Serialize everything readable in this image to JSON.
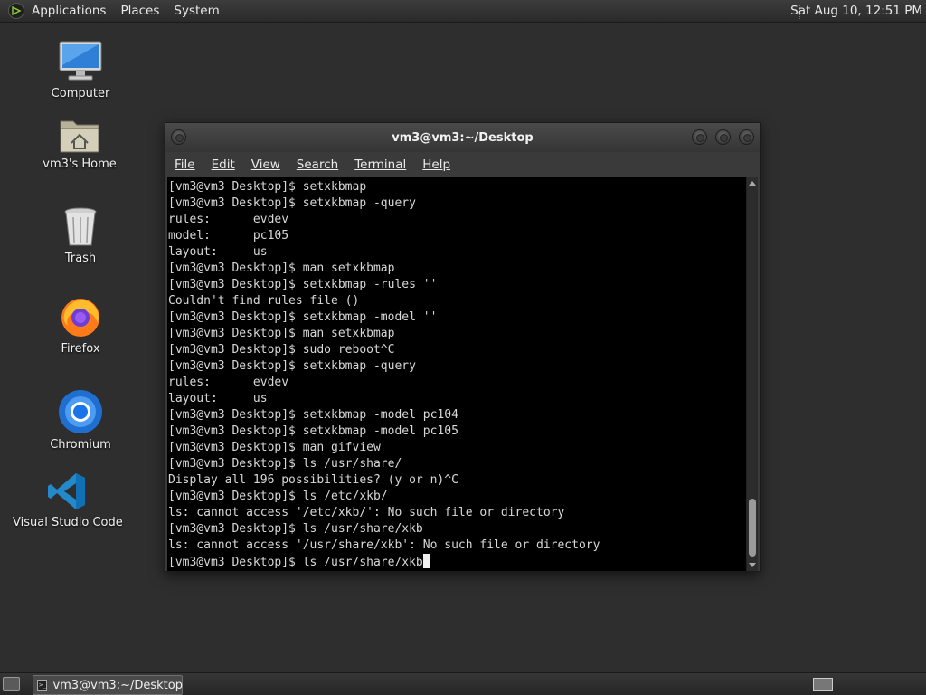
{
  "top_panel": {
    "menus": [
      "Applications",
      "Places",
      "System"
    ],
    "clock": "Sat Aug 10, 12:51 PM"
  },
  "desktop_icons": [
    {
      "label": "Computer",
      "icon": "computer-icon"
    },
    {
      "label": "vm3's Home",
      "icon": "home-folder-icon"
    },
    {
      "label": "Trash",
      "icon": "trash-icon"
    },
    {
      "label": "Firefox",
      "icon": "firefox-icon"
    },
    {
      "label": "Chromium",
      "icon": "chromium-icon"
    },
    {
      "label": "Visual Studio Code",
      "icon": "vscode-icon"
    }
  ],
  "terminal": {
    "title": "vm3@vm3:~/Desktop",
    "menu": [
      "File",
      "Edit",
      "View",
      "Search",
      "Terminal",
      "Help"
    ],
    "lines": [
      "[vm3@vm3 Desktop]$ setxkbmap",
      "[vm3@vm3 Desktop]$ setxkbmap -query",
      "rules:      evdev",
      "model:      pc105",
      "layout:     us",
      "[vm3@vm3 Desktop]$ man setxkbmap",
      "[vm3@vm3 Desktop]$ setxkbmap -rules ''",
      "Couldn't find rules file ()",
      "[vm3@vm3 Desktop]$ setxkbmap -model ''",
      "[vm3@vm3 Desktop]$ man setxkbmap",
      "[vm3@vm3 Desktop]$ sudo reboot^C",
      "[vm3@vm3 Desktop]$ setxkbmap -query",
      "rules:      evdev",
      "layout:     us",
      "[vm3@vm3 Desktop]$ setxkbmap -model pc104",
      "[vm3@vm3 Desktop]$ setxkbmap -model pc105",
      "[vm3@vm3 Desktop]$ man gifview",
      "[vm3@vm3 Desktop]$ ls /usr/share/",
      "Display all 196 possibilities? (y or n)^C",
      "[vm3@vm3 Desktop]$ ls /etc/xkb/",
      "ls: cannot access '/etc/xkb/': No such file or directory",
      "[vm3@vm3 Desktop]$ ls /usr/share/xkb",
      "ls: cannot access '/usr/share/xkb': No such file or directory"
    ],
    "current_input": "[vm3@vm3 Desktop]$ ls /usr/share/xkb"
  },
  "taskbar": {
    "tasks": [
      {
        "label": "vm3@vm3:~/Desktop",
        "icon": "terminal-icon"
      }
    ]
  }
}
